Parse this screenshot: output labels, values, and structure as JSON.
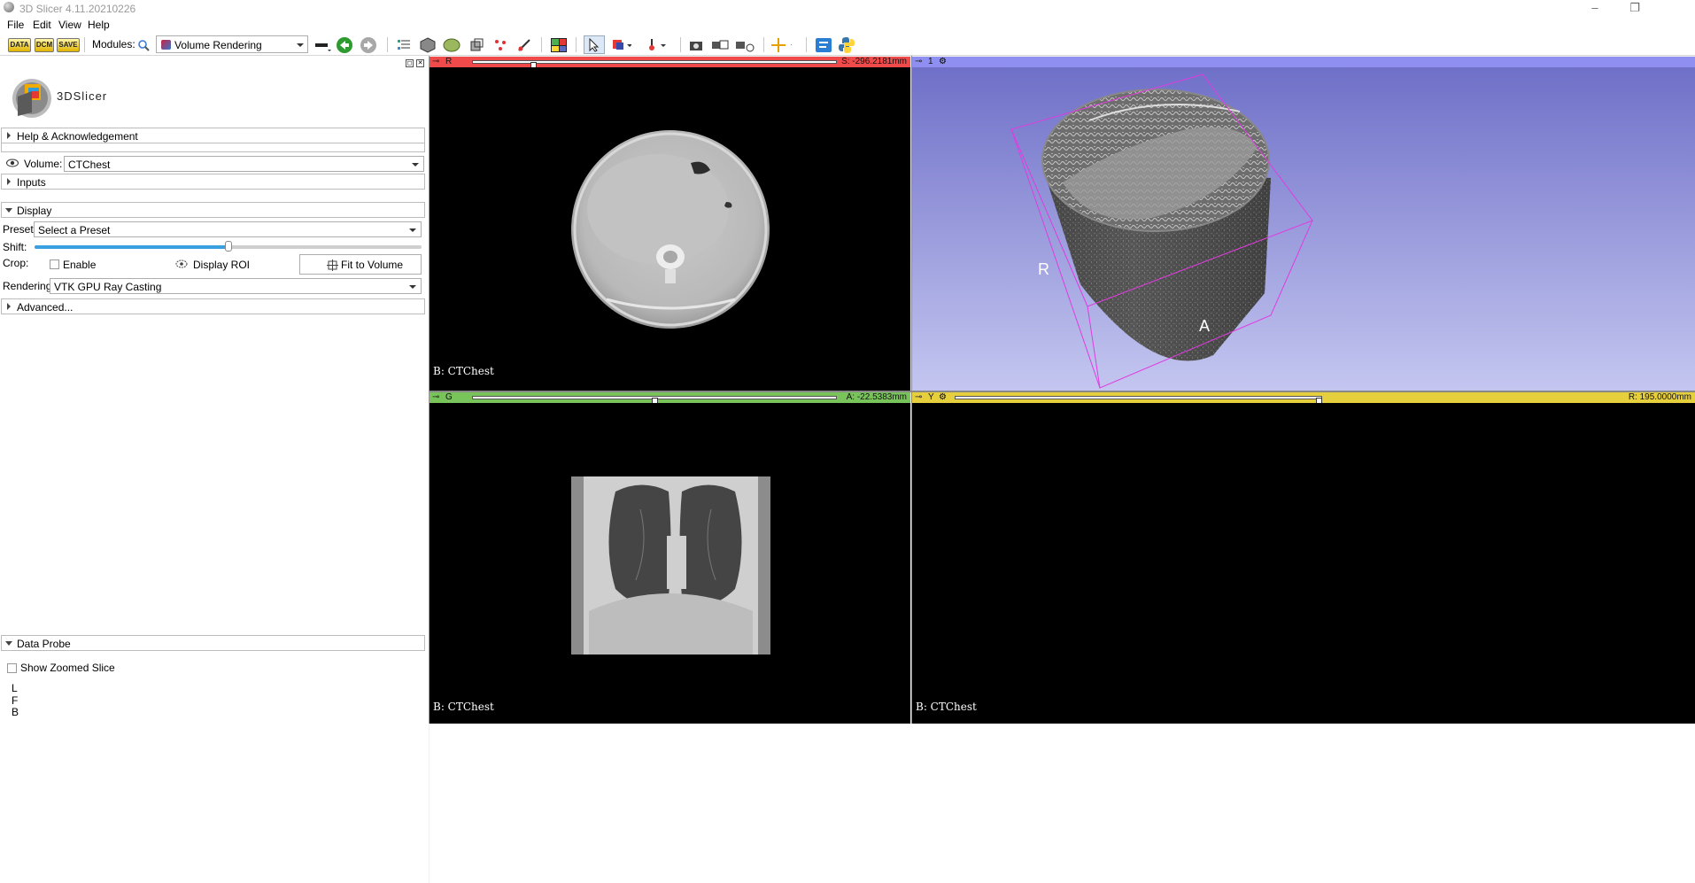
{
  "window": {
    "title": "3D Slicer 4.11.20210226",
    "controls": [
      "–",
      "❐"
    ]
  },
  "menu": {
    "items": [
      "File",
      "Edit",
      "View",
      "Help"
    ]
  },
  "toolbar": {
    "data_label": "DATA",
    "dcm_label": "DCM",
    "save_label": "SAVE",
    "modules_label": "Modules:",
    "module_value": "Volume Rendering"
  },
  "logo": {
    "text": "3DSlicer"
  },
  "sections": {
    "help": "Help & Acknowledgement",
    "inputs": "Inputs",
    "display": "Display",
    "advanced": "Advanced...",
    "data_probe": "Data Probe"
  },
  "volume": {
    "label": "Volume:",
    "value": "CTChest"
  },
  "display": {
    "preset_label": "Preset:",
    "preset_value": "Select a Preset",
    "shift_label": "Shift:",
    "shift_fraction": 0.5,
    "crop_label": "Crop:",
    "enable_label": "Enable",
    "display_roi_label": "Display ROI",
    "fit_button": "Fit to Volume",
    "rendering_label": "Rendering:",
    "rendering_value": "VTK GPU Ray Casting"
  },
  "probe": {
    "show_zoomed": "Show Zoomed Slice",
    "lines": [
      "L",
      "F",
      "B"
    ]
  },
  "views": {
    "red": {
      "letter": "R",
      "coord": "S: -296.2181mm",
      "label": "B: CTChest",
      "color": "#f04a4a",
      "slider_fraction": 0.16
    },
    "threeD": {
      "letter": "1",
      "color": "#8e8ff0",
      "orient_r": "R",
      "orient_a": "A"
    },
    "green": {
      "letter": "G",
      "coord": "A: -22.5383mm",
      "label": "B: CTChest",
      "color": "#79c35b",
      "slider_fraction": 0.5
    },
    "yellow": {
      "letter": "Y",
      "coord": "R: 195.0000mm",
      "label": "B: CTChest",
      "color": "#e6cf3d",
      "slider_fraction": 1.0
    }
  },
  "colors": {
    "view3d_top": "#6f70c8",
    "view3d_bottom": "#c4c6f0",
    "roi_box": "#e03ce0"
  }
}
